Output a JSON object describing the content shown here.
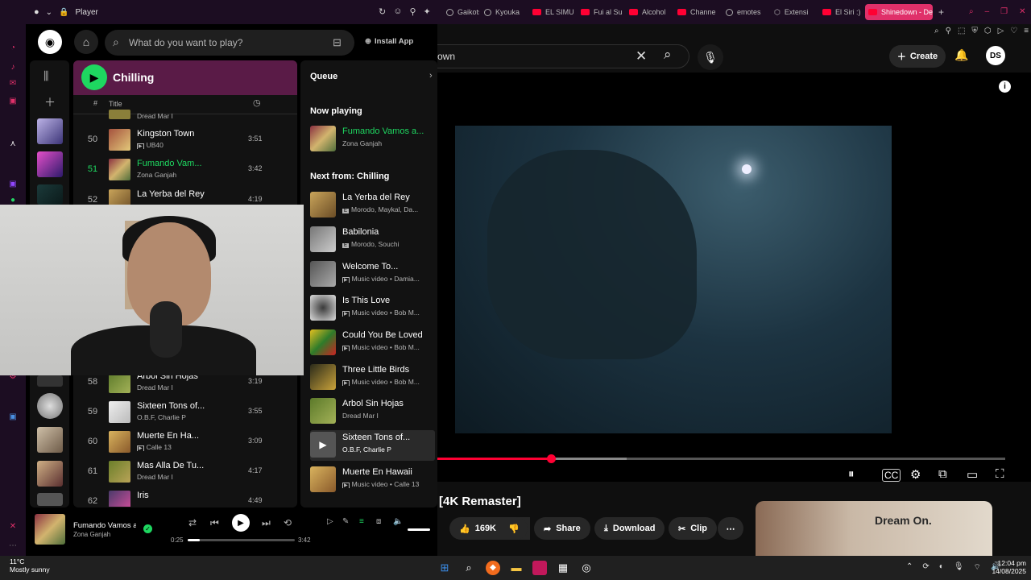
{
  "browser": {
    "popup_title": "Player",
    "tabs": [
      {
        "label": "Gaikots"
      },
      {
        "label": "Kyouka"
      },
      {
        "label": "EL SIMU"
      },
      {
        "label": "Fui al Su"
      },
      {
        "label": "Alcohol"
      },
      {
        "label": "Channe"
      },
      {
        "label": "emotes"
      },
      {
        "label": "Extensi"
      },
      {
        "label": "El Siri :)"
      },
      {
        "label": "Shinedown - De"
      }
    ]
  },
  "spotify": {
    "search_placeholder": "What do you want to play?",
    "install_app": "Install App",
    "playlist_title": "Chilling",
    "col_hash": "#",
    "col_title": "Title",
    "tracks_top": [
      {
        "num": "",
        "title": "",
        "artist": "Dread Mar I",
        "duration": ""
      },
      {
        "num": "50",
        "title": "Kingston Town",
        "artist": "UB40",
        "duration": "3:51"
      },
      {
        "num": "51",
        "title": "Fumando Vam...",
        "artist": "Zona Ganjah",
        "duration": "3:42"
      },
      {
        "num": "52",
        "title": "La Yerba del Rey",
        "artist": "",
        "duration": "4:19"
      }
    ],
    "tracks_bottom": [
      {
        "num": "58",
        "title": "Arbol Sin Hojas",
        "artist": "Dread Mar I",
        "duration": "3:19"
      },
      {
        "num": "59",
        "title": "Sixteen Tons of...",
        "artist": "O.B.F, Charlie P",
        "duration": "3:55"
      },
      {
        "num": "60",
        "title": "Muerte En Ha...",
        "artist": "Calle 13",
        "duration": "3:09"
      },
      {
        "num": "61",
        "title": "Mas Alla De Tu...",
        "artist": "Dread Mar I",
        "duration": "4:17"
      },
      {
        "num": "62",
        "title": "Iris",
        "artist": "",
        "duration": "4:49"
      }
    ],
    "queue": {
      "heading": "Queue",
      "now_playing_label": "Now playing",
      "now_playing": {
        "title": "Fumando Vamos a...",
        "artist": "Zona Ganjah"
      },
      "next_from_label": "Next from: Chilling",
      "items": [
        {
          "title": "La Yerba del Rey",
          "artist": "Morodo, Maykal, Da..."
        },
        {
          "title": "Babilonia",
          "artist": "Morodo, Souchi"
        },
        {
          "title": "Welcome To...",
          "artist": "Music video • Damia..."
        },
        {
          "title": "Is This Love",
          "artist": "Music video • Bob M..."
        },
        {
          "title": "Could You Be Loved",
          "artist": "Music video • Bob M..."
        },
        {
          "title": "Three Little Birds",
          "artist": "Music video • Bob M..."
        },
        {
          "title": "Arbol Sin Hojas",
          "artist": "Dread Mar I"
        },
        {
          "title": "Sixteen Tons of...",
          "artist": "O.B.F, Charlie P"
        },
        {
          "title": "Muerte En Hawaii",
          "artist": "Music video • Calle 13"
        }
      ]
    },
    "player": {
      "title": "Fumando Vamos a C",
      "artist": "Zona Ganjah",
      "current_time": "0:25",
      "total_time": "3:42",
      "progress": 0.11
    }
  },
  "youtube": {
    "search_value": "own",
    "create_label": "Create",
    "avatar_label": "DS",
    "video_title": "[4K Remaster]",
    "likes": "169K",
    "share": "Share",
    "download": "Download",
    "clip": "Clip",
    "suggestion_title": "Dream On.",
    "progress": 0.2
  },
  "taskbar": {
    "temp": "11°C",
    "weather": "Mostly sunny",
    "time": "12:04 pm",
    "date": "14/08/2025"
  },
  "colors": {
    "spotify_green": "#1ed760",
    "youtube_red": "#ff0033",
    "opera_accent": "#e0306a",
    "playlist_header": "#5a1b47"
  }
}
